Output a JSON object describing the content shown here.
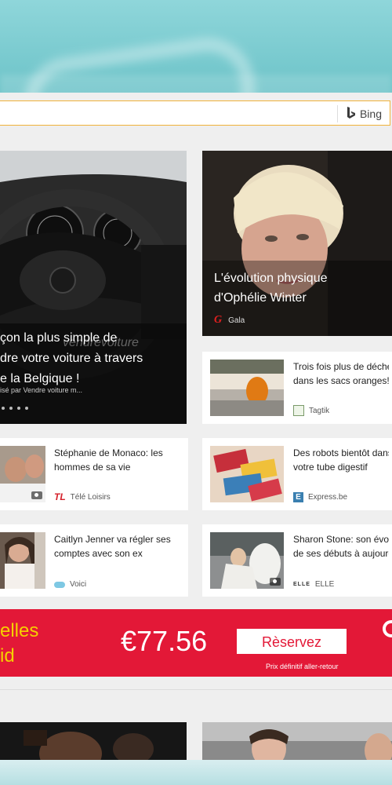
{
  "search": {
    "placeholder": "",
    "value": "",
    "engine_label": "Bing"
  },
  "hero_left": {
    "title_line1": "çon la plus simple de",
    "title_line2": "dre votre voiture à travers",
    "title_line3": "e la Belgique !",
    "source": "isé par Vendre voiture m...",
    "watermark": "vendrevoiture"
  },
  "hero_right": {
    "title_line1": "L'évolution physique",
    "title_line2": "d'Ophélie Winter",
    "source": "Gala"
  },
  "news": [
    {
      "title1": "Trois fois plus de déche",
      "title2": "dans les sacs oranges!",
      "source": "Tagtik"
    },
    {
      "title1": "Stéphanie de Monaco: les",
      "title2": "hommes de sa vie",
      "source": "Télé Loisirs"
    },
    {
      "title1": "Des robots bientôt dans",
      "title2": "votre tube digestif",
      "source": "Express.be"
    },
    {
      "title1": "Caitlyn Jenner va régler ses",
      "title2": "comptes avec son ex",
      "source": "Voici"
    },
    {
      "title1": "Sharon Stone: son évolu",
      "title2": "de ses débuts à aujourd",
      "source": "ELLE"
    }
  ],
  "ad": {
    "left_line1": "elles",
    "left_line2": "id",
    "price": "€77.56",
    "button": "Rèservez",
    "fine_print": "Prix définitif aller-retour"
  },
  "colors": {
    "accent_border": "#f0b23a",
    "ad_red": "#e31837",
    "ad_yellow": "#f5d000"
  }
}
